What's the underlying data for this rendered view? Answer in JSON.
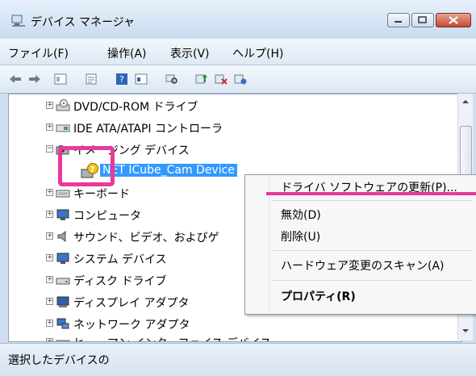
{
  "window": {
    "title": "デバイス マネージャ"
  },
  "menu": [
    "ファイル(F)",
    "操作(A)",
    "表示(V)",
    "ヘルプ(H)"
  ],
  "tree": [
    {
      "label": "DVD/CD-ROM ドライブ",
      "icon": "dvd-drive-icon"
    },
    {
      "label": "IDE ATA/ATAPI コントローラ",
      "icon": "ide-controller-icon"
    },
    {
      "label": "イメージング デバイス",
      "icon": "camera-icon"
    },
    {
      "label": "NET ICube_Cam Device",
      "icon": "warning-device-icon"
    },
    {
      "label": "キーボード",
      "icon": "keyboard-icon"
    },
    {
      "label": "コンピュータ",
      "icon": "computer-icon"
    },
    {
      "label": "サウンド、ビデオ、およびゲ",
      "icon": "speaker-icon"
    },
    {
      "label": "システム デバイス",
      "icon": "system-device-icon"
    },
    {
      "label": "ディスク ドライブ",
      "icon": "disk-drive-icon"
    },
    {
      "label": "ディスプレイ アダプタ",
      "icon": "display-adapter-icon"
    },
    {
      "label": "ネットワーク アダプタ",
      "icon": "network-adapter-icon"
    },
    {
      "label": "ヒューマン インターフェイス デバイス",
      "icon": "hid-icon"
    }
  ],
  "context_menu": [
    "ドライバ ソフトウェアの更新(P)...",
    "無効(D)",
    "削除(U)",
    "ハードウェア変更のスキャン(A)",
    "プロパティ(R)"
  ],
  "status": {
    "text": "選択したデバイスの"
  },
  "colors": {
    "highlight": "#e8399c",
    "selection": "#3399ff"
  }
}
